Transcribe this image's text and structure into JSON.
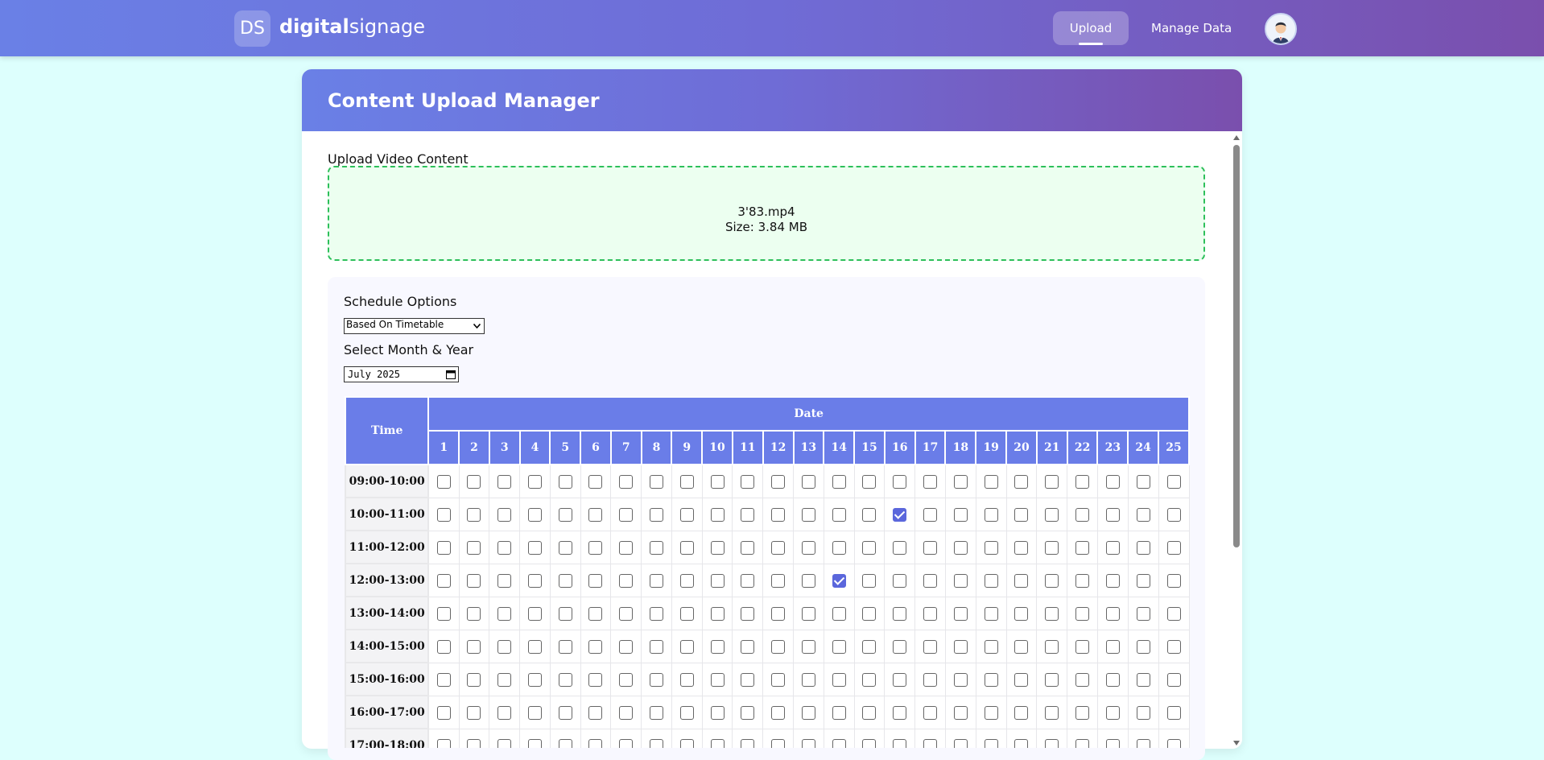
{
  "brand": {
    "badge": "DS",
    "name_bold": "digital",
    "name_light": "signage"
  },
  "nav": {
    "upload": "Upload",
    "manage": "Manage Data"
  },
  "page": {
    "title": "Content Upload Manager"
  },
  "upload": {
    "label": "Upload Video Content",
    "file_name": "3'83.mp4",
    "file_size": "Size: 3.84 MB"
  },
  "schedule": {
    "label": "Schedule Options",
    "selected_option": "Based On Timetable",
    "month_label": "Select Month & Year",
    "month_value": "July 2025"
  },
  "table": {
    "time_header": "Time",
    "date_header": "Date",
    "days": [
      "1",
      "2",
      "3",
      "4",
      "5",
      "6",
      "7",
      "8",
      "9",
      "10",
      "11",
      "12",
      "13",
      "14",
      "15",
      "16",
      "17",
      "18",
      "19",
      "20",
      "21",
      "22",
      "23",
      "24",
      "25"
    ],
    "slots": [
      "09:00-10:00",
      "10:00-11:00",
      "11:00-12:00",
      "12:00-13:00",
      "13:00-14:00",
      "14:00-15:00",
      "15:00-16:00",
      "16:00-17:00",
      "17:00-18:00"
    ],
    "checked": [
      {
        "slot": "10:00-11:00",
        "day": "16"
      },
      {
        "slot": "12:00-13:00",
        "day": "14"
      }
    ]
  },
  "colors": {
    "accent": "#6a7de8",
    "gradient_start": "#6a80e6",
    "gradient_end": "#7a4fad",
    "dropzone_border": "#2dbf5a",
    "page_bg": "#ddfffd"
  },
  "icons": {
    "avatar": "user-avatar-icon",
    "calendar": "calendar-icon"
  }
}
